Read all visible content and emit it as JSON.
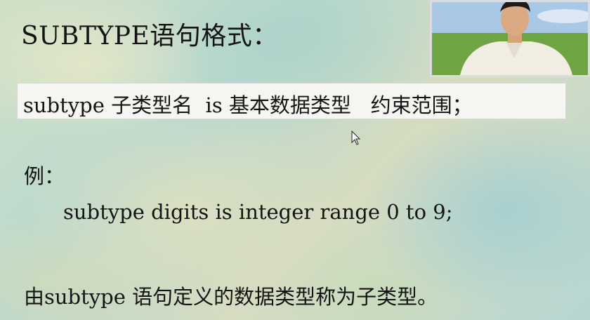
{
  "slide": {
    "title": "SUBTYPE语句格式：",
    "syntax": "subtype 子类型名  is 基本数据类型   约束范围；",
    "example_label": "例：",
    "example_code": "subtype digits is integer range 0 to 9;",
    "conclusion": "由subtype 语句定义的数据类型称为子类型。"
  },
  "icons": {
    "cursor": "mouse-pointer-icon",
    "presenter": "presenter-video-icon"
  },
  "colors": {
    "text": "#141414",
    "syntax_box": "#f5f5f2",
    "inset_border": "#d9dce0"
  }
}
